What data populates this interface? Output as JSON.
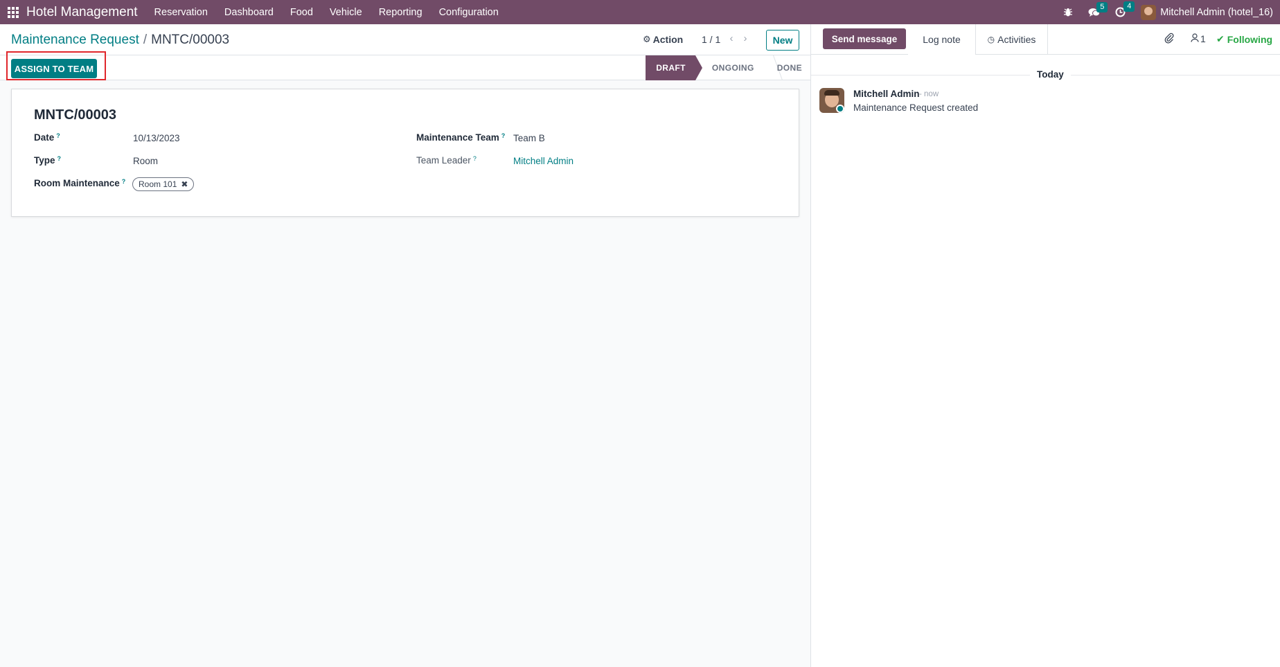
{
  "navbar": {
    "brand": "Hotel Management",
    "menu": [
      "Reservation",
      "Dashboard",
      "Food",
      "Vehicle",
      "Reporting",
      "Configuration"
    ],
    "messages_count": "5",
    "activities_count": "4",
    "user": "Mitchell Admin (hotel_16)"
  },
  "control": {
    "breadcrumb_parent": "Maintenance Request",
    "breadcrumb_current": "MNTC/00003",
    "action_label": "Action",
    "pager": "1 / 1",
    "new_label": "New"
  },
  "statusbar": {
    "assign_label": "ASSIGN TO TEAM",
    "stages": [
      "DRAFT",
      "ONGOING",
      "DONE"
    ],
    "current_stage": "DRAFT"
  },
  "form": {
    "name": "MNTC/00003",
    "date_label": "Date",
    "date_value": "10/13/2023",
    "type_label": "Type",
    "type_value": "Room",
    "room_label": "Room Maintenance",
    "room_tag": "Room 101",
    "team_label": "Maintenance Team",
    "team_value": "Team B",
    "leader_label": "Team Leader",
    "leader_value": "Mitchell Admin",
    "help_mark": "?"
  },
  "chatter": {
    "send_label": "Send message",
    "log_label": "Log note",
    "activities_label": "Activities",
    "followers_count": "1",
    "following_label": "Following",
    "date_separator": "Today",
    "message": {
      "author": "Mitchell Admin",
      "time": "- now",
      "body": "Maintenance Request created"
    }
  },
  "colors": {
    "brand": "#714b67",
    "accent": "#017e84",
    "highlight": "#e0262b",
    "following": "#28a745"
  }
}
